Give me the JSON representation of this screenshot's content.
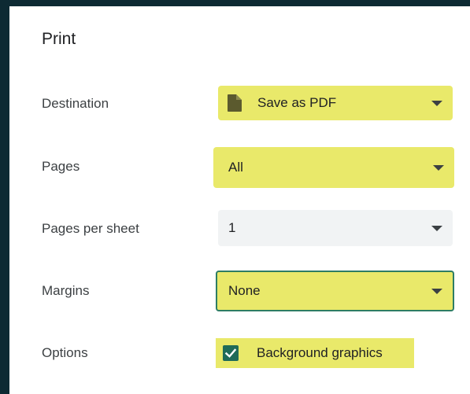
{
  "dialog": {
    "title": "Print"
  },
  "destination": {
    "label": "Destination",
    "value": "Save as PDF",
    "icon": "pdf-file-icon"
  },
  "pages": {
    "label": "Pages",
    "value": "All"
  },
  "pages_per_sheet": {
    "label": "Pages per sheet",
    "value": "1"
  },
  "margins": {
    "label": "Margins",
    "value": "None"
  },
  "options": {
    "label": "Options",
    "background_graphics": {
      "label": "Background graphics",
      "checked": true
    }
  },
  "colors": {
    "highlight": "#e9e96a",
    "check_accent": "#1f6b58",
    "focus_border": "#2e7d64"
  }
}
